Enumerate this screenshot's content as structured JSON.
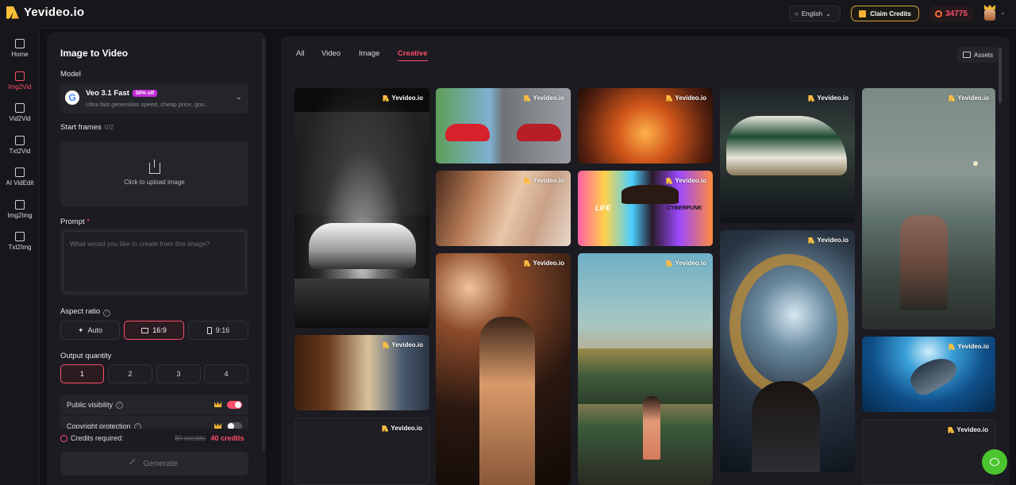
{
  "app": {
    "name": "Yevideo.io"
  },
  "header": {
    "language": "English",
    "claim_label": "Claim Credits",
    "credits": "34775"
  },
  "rail": [
    {
      "label": "Home",
      "icon": "home-icon"
    },
    {
      "label": "Img2Vid",
      "icon": "image-video-icon",
      "active": true
    },
    {
      "label": "Vid2Vid",
      "icon": "video-icon"
    },
    {
      "label": "Txt2Vid",
      "icon": "text-icon"
    },
    {
      "label": "AI VidEdit",
      "icon": "sparkle-icon"
    },
    {
      "label": "Img2Img",
      "icon": "image-icon"
    },
    {
      "label": "Txt2Img",
      "icon": "image-text-icon"
    }
  ],
  "panel": {
    "title": "Image to Video",
    "model_label": "Model",
    "model": {
      "name": "Veo 3.1 Fast",
      "badge": "50% off",
      "description": "Ultra fast generation speed, cheap price, goo...",
      "logo": "G"
    },
    "start_frames_label": "Start frames",
    "start_frames_count": "0/2",
    "upload_text": "Click to upload image",
    "prompt_label": "Prompt",
    "prompt_required": "*",
    "prompt_placeholder": "What would you like to create from this image?",
    "aspect_label": "Aspect ratio",
    "aspect_options": [
      "Auto",
      "16:9",
      "9:16"
    ],
    "aspect_selected": "16:9",
    "quantity_label": "Output quantity",
    "quantity_options": [
      "1",
      "2",
      "3",
      "4"
    ],
    "quantity_selected": "1",
    "public_visibility_label": "Public visibility",
    "public_visibility_on": true,
    "copyright_label": "Copyright protection",
    "copyright_on": false,
    "credits_required_label": "Credits required:",
    "credits_old": "80 credits",
    "credits_new": "40 credits",
    "generate_label": "Generate"
  },
  "gallery": {
    "tabs": [
      "All",
      "Video",
      "Image",
      "Creative"
    ],
    "active_tab": "Creative",
    "assets_label": "Assets",
    "watermark": "Yevideo.io",
    "card8_text_left": "LIFE",
    "card8_text_right": "CYBERPUNK"
  }
}
